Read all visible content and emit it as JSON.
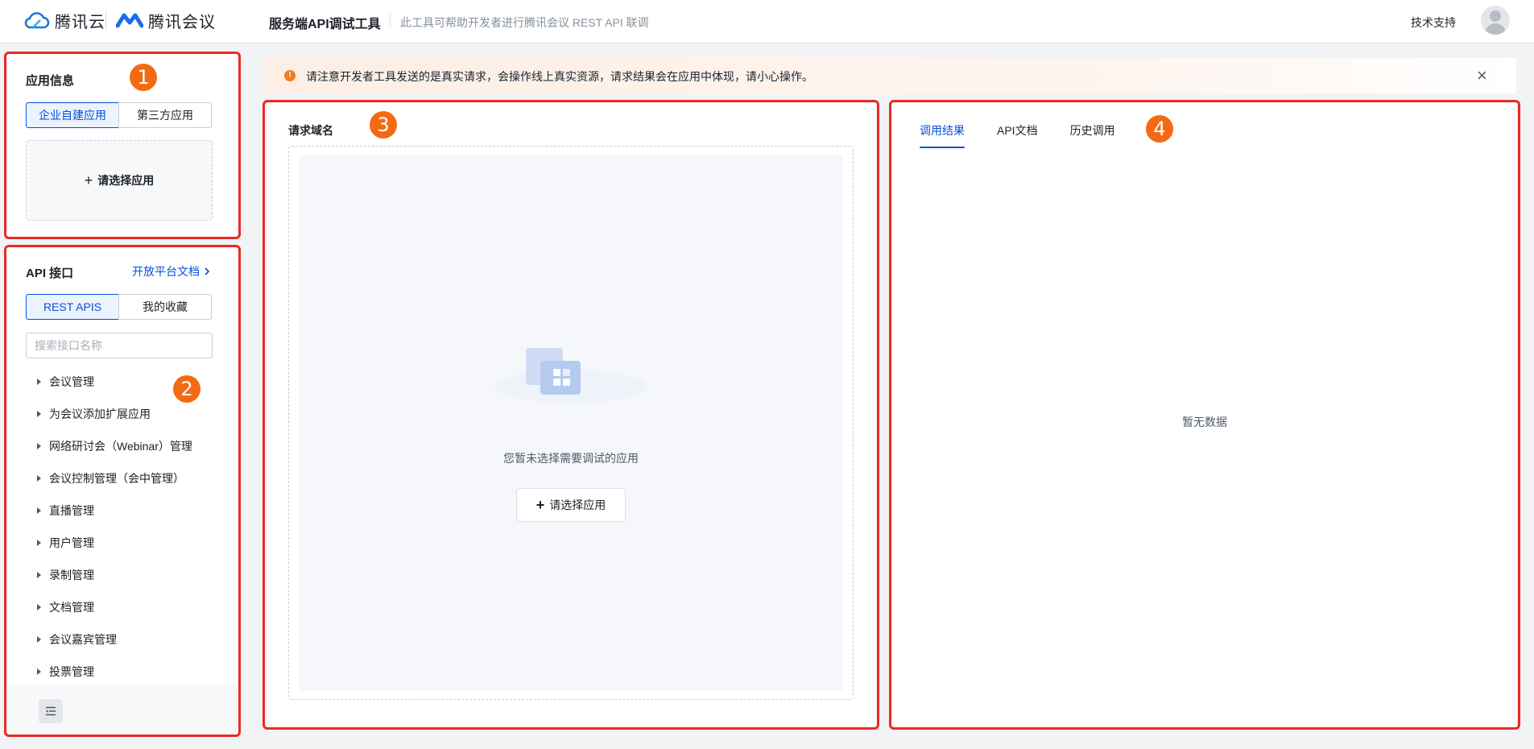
{
  "header": {
    "brand_cloud": "腾讯云",
    "brand_meeting": "腾讯会议",
    "tool_title": "服务端API调试工具",
    "tool_desc": "此工具可帮助开发者进行腾讯会议 REST API 联调",
    "support": "技术支持"
  },
  "app_panel": {
    "title": "应用信息",
    "badge": "1",
    "tabs": [
      "企业自建应用",
      "第三方应用"
    ],
    "select_app": "请选择应用"
  },
  "api_panel": {
    "title": "API 接口",
    "badge": "2",
    "doc_link": "开放平台文档",
    "tabs": [
      "REST APIS",
      "我的收藏"
    ],
    "search_placeholder": "搜索接口名称",
    "items": [
      "会议管理",
      "为会议添加扩展应用",
      "网络研讨会（Webinar）管理",
      "会议控制管理（会中管理）",
      "直播管理",
      "用户管理",
      "录制管理",
      "文档管理",
      "会议嘉宾管理",
      "投票管理"
    ]
  },
  "warning": {
    "text": "请注意开发者工具发送的是真实请求，会操作线上真实资源，请求结果会在应用中体现，请小心操作。"
  },
  "request_panel": {
    "label": "请求域名",
    "badge": "3",
    "empty_text": "您暂未选择需要调试的应用",
    "choose_button": "请选择应用"
  },
  "result_panel": {
    "badge": "4",
    "tabs": [
      "调用结果",
      "API文档",
      "历史调用"
    ],
    "empty_text": "暂无数据"
  },
  "colors": {
    "accent": "#0052d9",
    "annotation_box": "#ea2a22",
    "annotation_badge": "#f46a12",
    "warning_icon": "#f07c24"
  }
}
